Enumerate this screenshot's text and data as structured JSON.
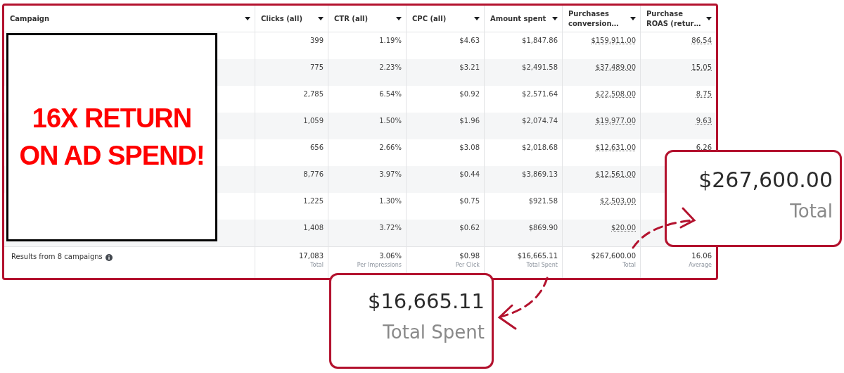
{
  "banner": {
    "text": "16X RETURN ON AD SPEND!"
  },
  "table": {
    "columns": [
      {
        "label": "Campaign"
      },
      {
        "label": "Clicks (all)",
        "underlined": false
      },
      {
        "label": "CTR (all)",
        "underlined": false
      },
      {
        "label": "CPC (all)",
        "underlined": false
      },
      {
        "label": "Amount spent",
        "underlined": false
      },
      {
        "label": "Purchases conversion…",
        "underlined": true
      },
      {
        "label": "Purchase ROAS (retur…",
        "underlined": true
      }
    ],
    "rows": [
      {
        "values": [
          "399",
          "1.19%",
          "$4.63",
          "$1,847.86",
          "$159,911.00",
          "86.54"
        ]
      },
      {
        "values": [
          "775",
          "2.23%",
          "$3.21",
          "$2,491.58",
          "$37,489.00",
          "15.05"
        ]
      },
      {
        "values": [
          "2,785",
          "6.54%",
          "$0.92",
          "$2,571.64",
          "$22,508.00",
          "8.75"
        ]
      },
      {
        "values": [
          "1,059",
          "1.50%",
          "$1.96",
          "$2,074.74",
          "$19,977.00",
          "9.63"
        ]
      },
      {
        "values": [
          "656",
          "2.66%",
          "$3.08",
          "$2,018.68",
          "$12,631.00",
          "6.26"
        ]
      },
      {
        "values": [
          "8,776",
          "3.97%",
          "$0.44",
          "$3,869.13",
          "$12,561.00"
        ]
      },
      {
        "values": [
          "1,225",
          "1.30%",
          "$0.75",
          "$921.58",
          "$2,503.00"
        ]
      },
      {
        "values": [
          "1,408",
          "3.72%",
          "$0.62",
          "$869.90",
          "$20.00"
        ]
      }
    ],
    "footer": {
      "label": "Results from 8 campaigns",
      "cells": [
        {
          "value": "17,083",
          "note": "Total"
        },
        {
          "value": "3.06%",
          "note": "Per Impressions"
        },
        {
          "value": "$0.98",
          "note": "Per Click"
        },
        {
          "value": "$16,665.11",
          "note": "Total Spent"
        },
        {
          "value": "$267,600.00",
          "note": "Total"
        },
        {
          "value": "16.06",
          "note": "Average"
        }
      ]
    }
  },
  "callouts": [
    {
      "value": "$267,600.00",
      "note": "Total"
    },
    {
      "value": "$16,665.11",
      "note": "Total Spent"
    }
  ]
}
